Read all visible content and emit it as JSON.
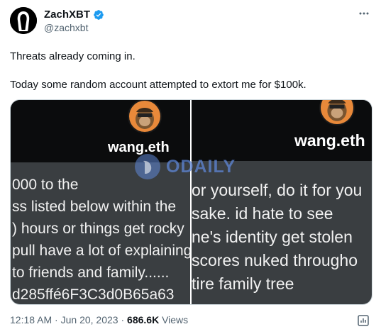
{
  "author": {
    "display_name": "ZachXBT",
    "handle": "@zachxbt",
    "avatar_icon": "hooded-figure-avatar",
    "verified_color": "#1d9bf0"
  },
  "tweet": {
    "line1": "Threats already coming in.",
    "line2": "Today some random account attempted to extort me for $100k."
  },
  "media": {
    "left": {
      "profile_name": "wang.eth",
      "lines": [
        "000 to the",
        "ss listed below within the",
        ") hours or things get rocky",
        "pull have a lot of explaining",
        "to friends and family......",
        "d285ffé6F3C3d0B65a63"
      ]
    },
    "right": {
      "profile_name": "wang.eth",
      "lines": [
        "or yourself, do it for you",
        "sake.  id hate to see",
        "ne's identity get stolen",
        "scores nuked througho",
        "tire family tree"
      ]
    },
    "watermark": "ODAILY"
  },
  "footer": {
    "time": "12:18 AM",
    "date": "Jun 20, 2023",
    "separator": "·",
    "views_count": "686.6K",
    "views_label": "Views"
  },
  "colors": {
    "text_primary": "#0f1419",
    "text_secondary": "#536471",
    "panel_bg": "#3a3e41",
    "panel_top": "#0b0c0d"
  }
}
